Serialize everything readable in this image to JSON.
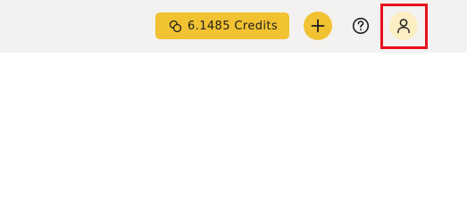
{
  "topbar": {
    "credits": {
      "label": "6.1485 Credits",
      "icon": "coins-icon"
    },
    "add_button": {
      "icon": "plus-icon"
    },
    "help_button": {
      "icon": "question-circle-icon"
    },
    "profile_button": {
      "icon": "user-icon",
      "highlighted": true
    }
  },
  "colors": {
    "topbar_bg": "#f3f2f0",
    "accent": "#f1c232",
    "profile_bg": "#fbeec3",
    "highlight_border": "#e8111d",
    "page_bg": "#ffffff"
  }
}
